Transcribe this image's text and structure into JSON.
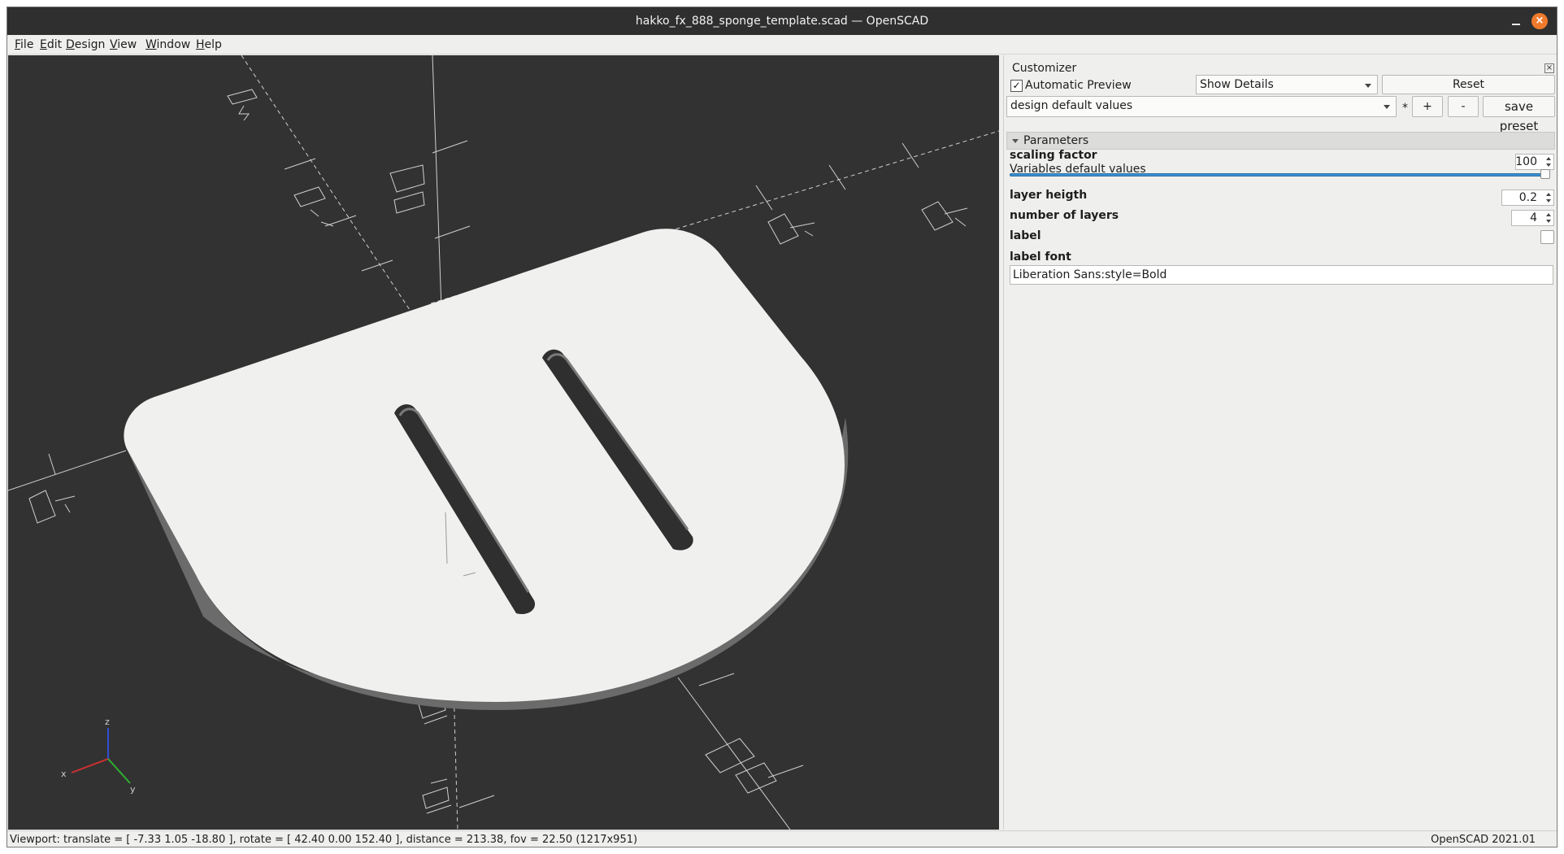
{
  "window": {
    "title": "hakko_fx_888_sponge_template.scad — OpenSCAD",
    "close_glyph": "×"
  },
  "menu": [
    "File",
    "Edit",
    "Design",
    "View",
    "Window",
    "Help"
  ],
  "viewport": {
    "background": "#323232",
    "model_color": "#f0f1ee",
    "axis_labels": {
      "x": "x",
      "y": "y",
      "z": "z"
    }
  },
  "customizer": {
    "title": "Customizer",
    "automatic_preview": {
      "label": "Automatic Preview",
      "checked": true,
      "check_glyph": "✓"
    },
    "details_mode": "Show Details",
    "reset_label": "Reset",
    "preset": {
      "value": "design default values",
      "modified_marker": "*",
      "add_label": "+",
      "remove_label": "-",
      "save_label": "save preset"
    },
    "section": "Parameters",
    "params": {
      "scaling_factor": {
        "label": "scaling factor",
        "description": "Variables default values",
        "value": "100",
        "slider_fraction": 1.0
      },
      "layer_height": {
        "label": "layer heigth",
        "value": "0.2"
      },
      "number_of_layers": {
        "label": "number of layers",
        "value": "4"
      },
      "label": {
        "label": "label",
        "checked": false
      },
      "label_font": {
        "label": "label font",
        "value": "Liberation Sans:style=Bold"
      }
    }
  },
  "status": {
    "viewport_info": "Viewport: translate = [ -7.33 1.05 -18.80 ], rotate = [ 42.40 0.00 152.40 ], distance = 213.38, fov = 22.50 (1217x951)",
    "version": "OpenSCAD 2021.01"
  }
}
